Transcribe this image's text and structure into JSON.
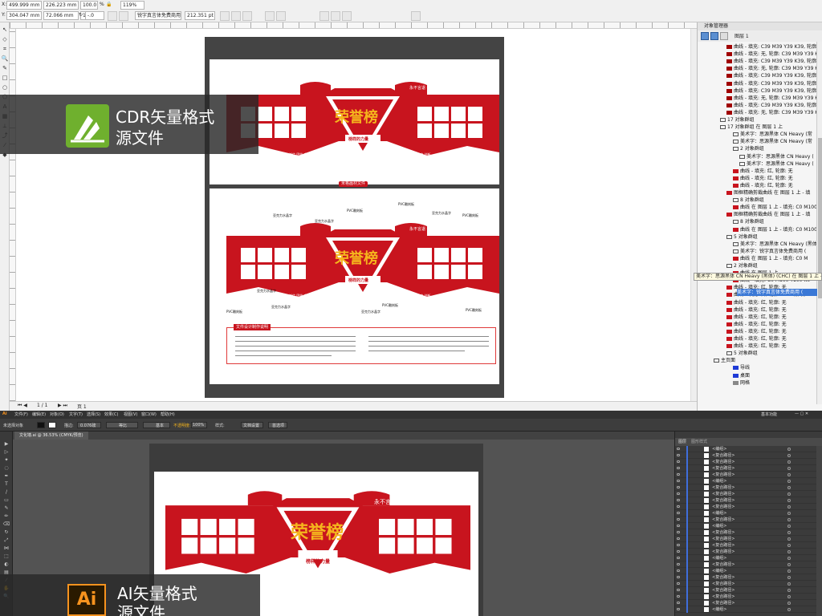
{
  "cdr": {
    "toolbar": {
      "x_value": "499.999 mm",
      "y_value": "304.047 mm",
      "w_value": "226.223 mm",
      "h_value": "72.066 mm",
      "pct1": "100.0",
      "pct2": "100.0",
      "pct_unit": "%",
      "rotation": "-.0",
      "zoom": "119%",
      "font_name": "锐字真言体免费商用",
      "font_size": "212.351 pt"
    },
    "status": {
      "pages": "1 / 1",
      "page_tab": "页 1"
    },
    "docker": {
      "title": "对象管理器",
      "layer_top": "图层 1"
    },
    "object_rows": [
      {
        "text": "曲线 - 填充: C39 M39 Y39 K39, 轮廓:",
        "color": "#a00000",
        "indent": 0
      },
      {
        "text": "曲线 - 填充: 无, 轮廓: C39 M39 Y39 K",
        "color": "#a00000",
        "indent": 0
      },
      {
        "text": "曲线 - 填充: C39 M39 Y39 K39, 轮廓:",
        "color": "#a00000",
        "indent": 0
      },
      {
        "text": "曲线 - 填充: 无, 轮廓: C39 M39 Y39 K",
        "color": "#a00000",
        "indent": 0
      },
      {
        "text": "曲线 - 填充: C39 M39 Y39 K39, 轮廓:",
        "color": "#a00000",
        "indent": 0
      },
      {
        "text": "曲线 - 填充: C39 M39 Y39 K39, 轮廓:",
        "color": "#a00000",
        "indent": 0
      },
      {
        "text": "曲线 - 填充: C39 M39 Y39 K39, 轮廓:",
        "color": "#a00000",
        "indent": 0
      },
      {
        "text": "曲线 - 填充: 无, 轮廓: C39 M39 Y39 K",
        "color": "#a00000",
        "indent": 0
      },
      {
        "text": "曲线 - 填充: C39 M39 Y39 K39, 轮廓:",
        "color": "#a00000",
        "indent": 0
      },
      {
        "text": "曲线 - 填充: 无, 轮廓: C39 M39 Y39 K",
        "color": "#a00000",
        "indent": 0
      },
      {
        "text": "17 对象群组",
        "color": "",
        "indent": -8
      },
      {
        "text": "17 对象群组 在 图层 1 上",
        "color": "",
        "indent": -8
      },
      {
        "text": "美术字：思源黑体 CN Heavy (常",
        "color": "",
        "indent": 8
      },
      {
        "text": "美术字：思源黑体 CN Heavy (常",
        "color": "",
        "indent": 8
      },
      {
        "text": "2 对象群组",
        "color": "",
        "indent": 8
      },
      {
        "text": "美术字：思源黑体 CN Heavy (",
        "color": "",
        "indent": 16
      },
      {
        "text": "美术字：思源黑体 CN Heavy (",
        "color": "",
        "indent": 16
      },
      {
        "text": "曲线 - 填充: 红, 轮廓: 无",
        "color": "#c8141e",
        "indent": 8
      },
      {
        "text": "曲线 - 填充: 红, 轮廓: 无",
        "color": "#c8141e",
        "indent": 8
      },
      {
        "text": "曲线 - 填充: 红, 轮廓: 无",
        "color": "#c8141e",
        "indent": 8
      },
      {
        "text": "图框精确剪裁曲线 在 图层 1 上 - 填",
        "color": "#c8141e",
        "indent": 0
      },
      {
        "text": "8 对象群组",
        "color": "",
        "indent": 8
      },
      {
        "text": "曲线 在 图层 1 上 - 填充: C0 M100",
        "color": "#c8141e",
        "indent": 8
      },
      {
        "text": "图框精确剪裁曲线 在 图层 1 上 - 填",
        "color": "#c8141e",
        "indent": 0
      },
      {
        "text": "8 对象群组",
        "color": "",
        "indent": 8
      },
      {
        "text": "曲线 在 图层 1 上 - 填充: C0 M100",
        "color": "#c8141e",
        "indent": 8
      },
      {
        "text": "5 对象群组",
        "color": "",
        "indent": 0
      },
      {
        "text": "美术字：思源黑体 CN Heavy (黑体) (CHC) 在 图层 1 上 - 填充",
        "color": "",
        "indent": 8
      },
      {
        "text": "美术字：锐字真言体免费商用 (",
        "color": "",
        "indent": 8
      },
      {
        "text": "曲线 在 图层 1 上 - 填充: C0 M",
        "color": "#c8141e",
        "indent": 8
      },
      {
        "text": "2 对象群组",
        "color": "",
        "indent": 0
      },
      {
        "text": "曲线 在 图层 1 上",
        "color": "#c8141e",
        "indent": 8
      },
      {
        "text": "曲线 - 填充: C0 M100 Y100 K0",
        "color": "#c8141e",
        "indent": 8
      },
      {
        "text": "曲线 - 填充: 红, 轮廓: 无",
        "color": "#c8141e",
        "indent": 0
      },
      {
        "text": "曲线 - 填充: 白, 轮廓: 40% 黑 发丝",
        "color": "#c8141e",
        "indent": 0
      },
      {
        "text": "曲线 - 填充: 红, 轮廓: 无",
        "color": "#c8141e",
        "indent": 0
      },
      {
        "text": "曲线 - 填充: 红, 轮廓: 无",
        "color": "#c8141e",
        "indent": 0
      },
      {
        "text": "曲线 - 填充: 红, 轮廓: 无",
        "color": "#c8141e",
        "indent": 0
      },
      {
        "text": "曲线 - 填充: 红, 轮廓: 无",
        "color": "#c8141e",
        "indent": 0
      },
      {
        "text": "曲线 - 填充: 红, 轮廓: 无",
        "color": "#c8141e",
        "indent": 0
      },
      {
        "text": "曲线 - 填充: 红, 轮廓: 无",
        "color": "#c8141e",
        "indent": 0
      },
      {
        "text": "曲线 - 填充: 红, 轮廓: 无",
        "color": "#c8141e",
        "indent": 0
      },
      {
        "text": "5 对象群组",
        "color": "",
        "indent": 0
      },
      {
        "text": "主页面",
        "color": "",
        "indent": -16
      },
      {
        "text": "导线",
        "color": "#1f3bd6",
        "indent": 8
      },
      {
        "text": "桌面",
        "color": "#1f3bd6",
        "indent": 8
      },
      {
        "text": "网格",
        "color": "#888888",
        "indent": 8
      }
    ],
    "tooltip": "美术字：思源黑体 CN Heavy (黑体) (CHC) 在 图层 1 上 - 填充: C0 M",
    "selected_row": "美术字：锐字真言体免费商用 (",
    "design": {
      "slogan_left": "突破自己 越努力 越幸运",
      "slogan_right": "永不言退 我们是最好的团队",
      "title": "荣誉榜",
      "subtitle": "榜样的力量",
      "footer_left": "诚信 团结 奋进",
      "footer_right": "开拓 求实 创新",
      "material_label": "米格画材文件",
      "info_title": "文件设计制作说明",
      "ann_pvc1": "PVC雕刻板",
      "ann_pvc2": "PVC雕刻板",
      "ann_pvc3": "PVC雕刻板",
      "ann_acrylic1": "亚克力水晶字",
      "ann_acrylic2": "亚克力水晶字",
      "ann_acrylic3": "亚克力水晶字",
      "ann_acrylic4": "亚克力水晶字",
      "ann_pvc_bottom1": "PVC雕刻板",
      "ann_pvc_bottom2": "PVC雕刻板",
      "ann_pvc_bottom3": "PVC雕刻板",
      "ann_acrylic_bottom": "亚克力水晶字",
      "ann_acrylic_mid": "亚克力水晶字"
    },
    "overlay_title_1": "CDR矢量格式",
    "overlay_title_2": "源文件"
  },
  "ai": {
    "app_icon": "Ai",
    "menu": [
      "文件(F)",
      "编辑(E)",
      "对象(O)",
      "文字(T)",
      "选择(S)",
      "效果(C)",
      "视图(V)",
      "窗口(W)",
      "帮助(H)"
    ],
    "workspace": "基本功能",
    "ctrl": {
      "mode": "未选择对象",
      "stroke_label": "描边:",
      "stroke_value": "0.076磅",
      "uniform": "等比",
      "basic": "基本",
      "opacity_label": "不透明度:",
      "opacity_value": "100%",
      "style": "样式:",
      "doc_setup": "文档设置",
      "prefs": "首选项"
    },
    "doc_tab": "文化墙.ai @ 36.53% (CMYK/预览)",
    "panel_tabs": [
      "图层",
      "图形样式"
    ],
    "layer_rows": [
      "<编组>",
      "<复合路径>",
      "<复合路径>",
      "<复合路径>",
      "<复合路径>",
      "<编组>",
      "<复合路径>",
      "<复合路径>",
      "<复合路径>",
      "<复合路径>",
      "<编组>",
      "<复合路径>",
      "<编组>",
      "<复合路径>",
      "<复合路径>",
      "<复合路径>",
      "<复合路径>",
      "<编组>",
      "<复合路径>",
      "<编组>",
      "<复合路径>",
      "<复合路径>",
      "<复合路径>",
      "<复合路径>",
      "<复合路径>",
      "<编组>"
    ],
    "overlay_title_1": "AI矢量格式",
    "overlay_title_2": "源文件"
  },
  "colors": {
    "accent_red": "#c8141e",
    "title_gold": "#f5b51d",
    "cdr_green": "#6fb02e",
    "ai_orange": "#f7931e",
    "selection_blue": "#3a78d6"
  }
}
